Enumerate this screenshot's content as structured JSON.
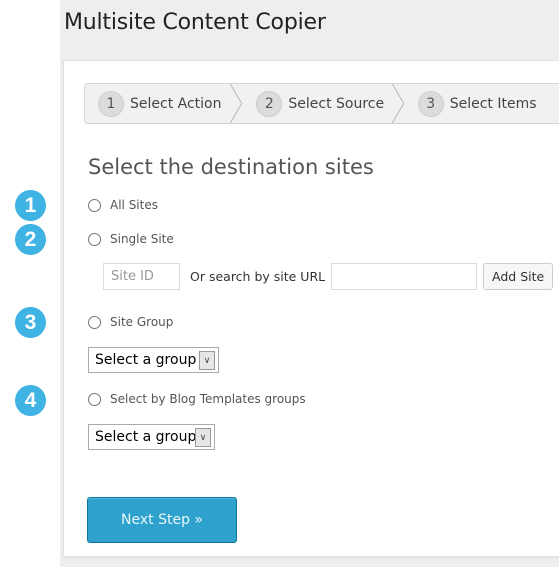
{
  "page": {
    "title": "Multisite Content Copier"
  },
  "steps": [
    {
      "number": "1",
      "label": "Select Action"
    },
    {
      "number": "2",
      "label": "Select Source"
    },
    {
      "number": "3",
      "label": "Select Items"
    }
  ],
  "section": {
    "heading": "Select the destination sites"
  },
  "badges": [
    "1",
    "2",
    "3",
    "4"
  ],
  "options": {
    "all_sites": {
      "label": "All Sites",
      "checked": false
    },
    "single_site": {
      "label": "Single Site",
      "checked": false
    },
    "site_group": {
      "label": "Site Group",
      "checked": false
    },
    "blog_templates": {
      "label": "Select by Blog Templates groups",
      "checked": false
    }
  },
  "single_site": {
    "site_id_placeholder": "Site ID",
    "site_id_value": "",
    "or_label": "Or search by site URL",
    "url_value": "",
    "add_button": "Add Site"
  },
  "site_group_select": {
    "selected": "Select a group"
  },
  "blog_templates_select": {
    "selected": "Select a group"
  },
  "next_button": "Next Step »",
  "colors": {
    "accent": "#2ea2cc",
    "badge": "#3fb3e4",
    "page_background": "#eeeeee"
  }
}
